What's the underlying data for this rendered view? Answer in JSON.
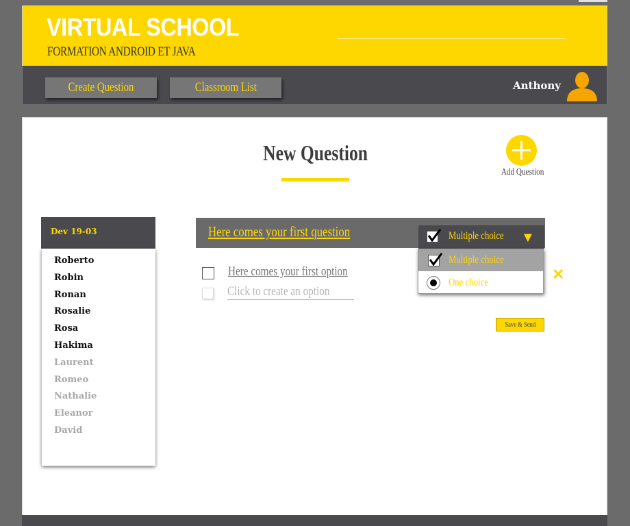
{
  "header": {
    "title": "VIRTUAL SCHOOL",
    "subtitle": "FORMATION ANDROID ET JAVA"
  },
  "nav": {
    "create_question": "Create Question",
    "classroom_list": "Classroom List",
    "username": "Anthony"
  },
  "page": {
    "title": "New Question",
    "add_question_label": "Add Question"
  },
  "classroom": {
    "name": "Dev 19-03",
    "students": [
      {
        "name": "Roberto",
        "active": true
      },
      {
        "name": "Robin",
        "active": true
      },
      {
        "name": "Ronan",
        "active": true
      },
      {
        "name": "Rosalie",
        "active": true
      },
      {
        "name": "Rosa",
        "active": true
      },
      {
        "name": "Hakima",
        "active": true
      },
      {
        "name": "Laurent",
        "active": false
      },
      {
        "name": "Romeo",
        "active": false
      },
      {
        "name": "Nathalie",
        "active": false
      },
      {
        "name": "Eleanor",
        "active": false
      },
      {
        "name": "David",
        "active": false
      }
    ]
  },
  "question": {
    "text": "Here comes your first question",
    "type_selected": "Multiple choice",
    "type_options": [
      "Multiple choice",
      "One choice"
    ],
    "options": [
      {
        "text": "Here comes your first option"
      }
    ],
    "add_option_placeholder": "Click to create an option",
    "save_label": "Save & Send"
  },
  "colors": {
    "accent": "#fed700",
    "dark": "#4a494e",
    "background": "#6b6b6b"
  },
  "icons": {
    "user": "user-icon",
    "add": "plus-circle-icon",
    "close": "close-icon",
    "caret": "caret-down-icon",
    "checkbox": "checkmark-icon",
    "radio": "radio-selected-icon"
  }
}
